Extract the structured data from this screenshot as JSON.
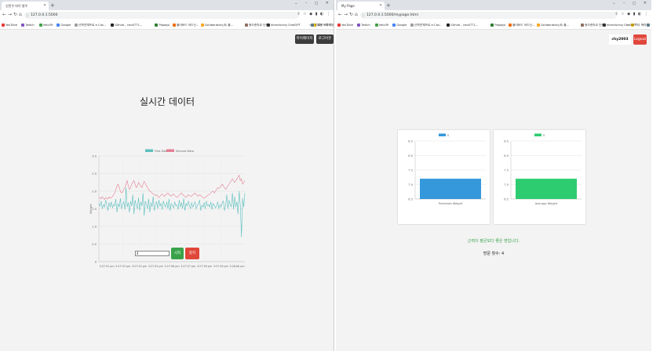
{
  "left_window": {
    "tab_title": "신민우 마이 봉우",
    "url": "127.0.0.1:5000",
    "bookmarks": [
      {
        "label": "YouTube",
        "color": "#e53935"
      },
      {
        "label": "Twitch",
        "color": "#7e57c2"
      },
      {
        "label": "Velo39",
        "color": "#43a047"
      },
      {
        "label": "Google",
        "color": "#4285f4"
      },
      {
        "label": "산학연계프로 e-Cas...",
        "color": "#9e9e9e"
      },
      {
        "label": "Github - ceo0771...",
        "color": "#222222"
      },
      {
        "label": "Papago",
        "color": "#2e7d32"
      },
      {
        "label": "불어토드 어드신...",
        "color": "#ef6c00"
      },
      {
        "label": "Colaboratory/트 폴...",
        "color": "#f9a825"
      },
      {
        "label": "증오준마르 단원",
        "color": "#8d6e63"
      },
      {
        "label": "Introducing ChatGPT",
        "color": "#333333"
      },
      {
        "label": "진료준 - 지역정 통...",
        "color": "#607d8b"
      }
    ],
    "bookmarks_more": "»",
    "other_bookmarks": "기타 북마크",
    "buttons": {
      "mypage": "마이페이지",
      "logout": "로그아웃"
    },
    "page_title": "실시간 데이터",
    "input_value": "4",
    "start_label": "시작",
    "stop_label": "중지"
  },
  "chart_data": [
    {
      "type": "line",
      "title": "",
      "xlabel": "",
      "ylabel": "Weight",
      "ylim": [
        0,
        3.0
      ],
      "yticks": [
        "0",
        "0.5",
        "1.0",
        "1.5",
        "2.0",
        "2.5",
        "3.0"
      ],
      "x_tick_labels": [
        "3:27:52 pm",
        "3:27:53 pm",
        "3:27:54 pm",
        "3:27:55 pm",
        "3:27:56 pm",
        "3:27:57 pm",
        "3:27:58 pm",
        "3:27:59 pm",
        "3:28:00 pm"
      ],
      "legend_position": "top",
      "grid": true,
      "series": [
        {
          "name": "First Data",
          "color": "#5dbfbf",
          "values": [
            1.65,
            1.58,
            1.72,
            1.5,
            1.62,
            1.55,
            1.75,
            1.6,
            1.45,
            1.68,
            1.55,
            1.7,
            1.52,
            1.63,
            1.58,
            1.78,
            1.4,
            1.65,
            1.55,
            1.8,
            1.5,
            1.62,
            1.7,
            1.48,
            2.1,
            1.55,
            1.68,
            1.4,
            1.72,
            1.58,
            1.9,
            1.35,
            1.75,
            1.6,
            1.5,
            1.82,
            1.45,
            1.7,
            1.58,
            1.95,
            1.3,
            1.72,
            1.62,
            1.5,
            1.78,
            1.4,
            1.68,
            1.55,
            1.85,
            1.45,
            1.62,
            1.7,
            1.5,
            1.75,
            1.58,
            1.65,
            1.48,
            1.72,
            1.6,
            1.55,
            1.7,
            1.5,
            1.78,
            1.45,
            1.65,
            1.6,
            1.52,
            1.7,
            1.58,
            1.62,
            1.48,
            1.75,
            1.55,
            1.68,
            1.5,
            1.8,
            1.45,
            1.65,
            1.58,
            1.72,
            1.6,
            1.5,
            1.68,
            1.55,
            1.62,
            1.7,
            1.5,
            1.58,
            1.65,
            1.75,
            1.45,
            1.6,
            1.55,
            1.68,
            1.5,
            1.72,
            1.58,
            1.62,
            1.55,
            1.7,
            1.48,
            1.65,
            1.6,
            1.52,
            1.58,
            1.7,
            1.5,
            1.62,
            1.55,
            1.68,
            1.72,
            1.45,
            1.6,
            1.9,
            1.5,
            1.75,
            1.62,
            1.55,
            1.95,
            1.48,
            1.85,
            1.55,
            1.7,
            1.35,
            2.0,
            1.6,
            0.7,
            1.8,
            1.55,
            1.95
          ],
          "note": ""
        },
        {
          "name": "Second Data",
          "color": "#e57f95",
          "values": [
            1.8,
            1.82,
            1.78,
            1.85,
            1.8,
            1.76,
            1.82,
            1.8,
            1.78,
            1.84,
            1.8,
            1.82,
            1.85,
            1.9,
            1.95,
            2.05,
            2.15,
            2.2,
            2.1,
            2.0,
            1.95,
            1.98,
            2.05,
            2.1,
            2.2,
            2.3,
            2.15,
            2.05,
            2.1,
            2.2,
            2.25,
            2.3,
            2.2,
            2.1,
            2.15,
            2.25,
            2.2,
            2.15,
            2.1,
            2.2,
            2.28,
            2.22,
            2.15,
            2.1,
            2.05,
            2.0,
            1.98,
            1.95,
            1.92,
            1.9,
            1.88,
            1.9,
            1.85,
            1.82,
            1.86,
            1.9,
            1.92,
            1.88,
            1.85,
            1.9,
            1.92,
            1.95,
            1.9,
            1.88,
            1.86,
            1.9,
            1.92,
            1.88,
            1.85,
            1.82,
            1.86,
            1.88,
            1.92,
            1.95,
            1.9,
            1.88,
            1.85,
            1.82,
            1.86,
            1.9,
            1.88,
            1.85,
            1.86,
            1.9,
            1.92,
            1.95,
            1.9,
            1.88,
            1.86,
            1.9,
            1.88,
            1.85,
            1.82,
            1.8,
            1.82,
            1.85,
            1.88,
            1.9,
            1.92,
            1.95,
            1.98,
            2.0,
            1.95,
            2.0,
            2.05,
            2.1,
            2.08,
            2.1,
            2.15,
            2.2,
            2.15,
            2.1,
            2.05,
            2.1,
            2.15,
            2.2,
            2.25,
            2.3,
            2.35,
            2.3,
            2.25,
            2.3,
            2.35,
            2.4,
            2.45,
            2.3,
            2.35,
            2.2,
            2.25,
            2.3
          ]
        }
      ]
    },
    {
      "type": "bar",
      "categories": [
        "Predicted Weight"
      ],
      "series": [
        {
          "name": "0",
          "color": "#3498db",
          "values": [
            7.2
          ]
        }
      ],
      "ylim": [
        6.5,
        8.5
      ],
      "yticks": [
        "6.5",
        "7.0",
        "7.5",
        "8.0",
        "8.5"
      ],
      "grid": true,
      "legend_position": "top"
    },
    {
      "type": "bar",
      "categories": [
        "Average Weight"
      ],
      "series": [
        {
          "name": "0",
          "color": "#2ecc71",
          "values": [
            7.2
          ]
        }
      ],
      "ylim": [
        6.5,
        8.5
      ],
      "yticks": [
        "6.5",
        "7.0",
        "7.5",
        "8.0",
        "8.5"
      ],
      "grid": true,
      "legend_position": "top"
    }
  ],
  "right_window": {
    "tab_title": "My Page",
    "url": "127.0.0.1:5000/mypage.html",
    "username": "chy2003",
    "logout_label": "Logout",
    "message": "근력이 평균보다 좋은 편입니다.",
    "count_text": "방문 횟수: 4"
  },
  "colors": {
    "green": "#3aa34a",
    "red": "#e0473a",
    "dark": "#3c3c3c",
    "page_bg": "#f3f3f3"
  }
}
